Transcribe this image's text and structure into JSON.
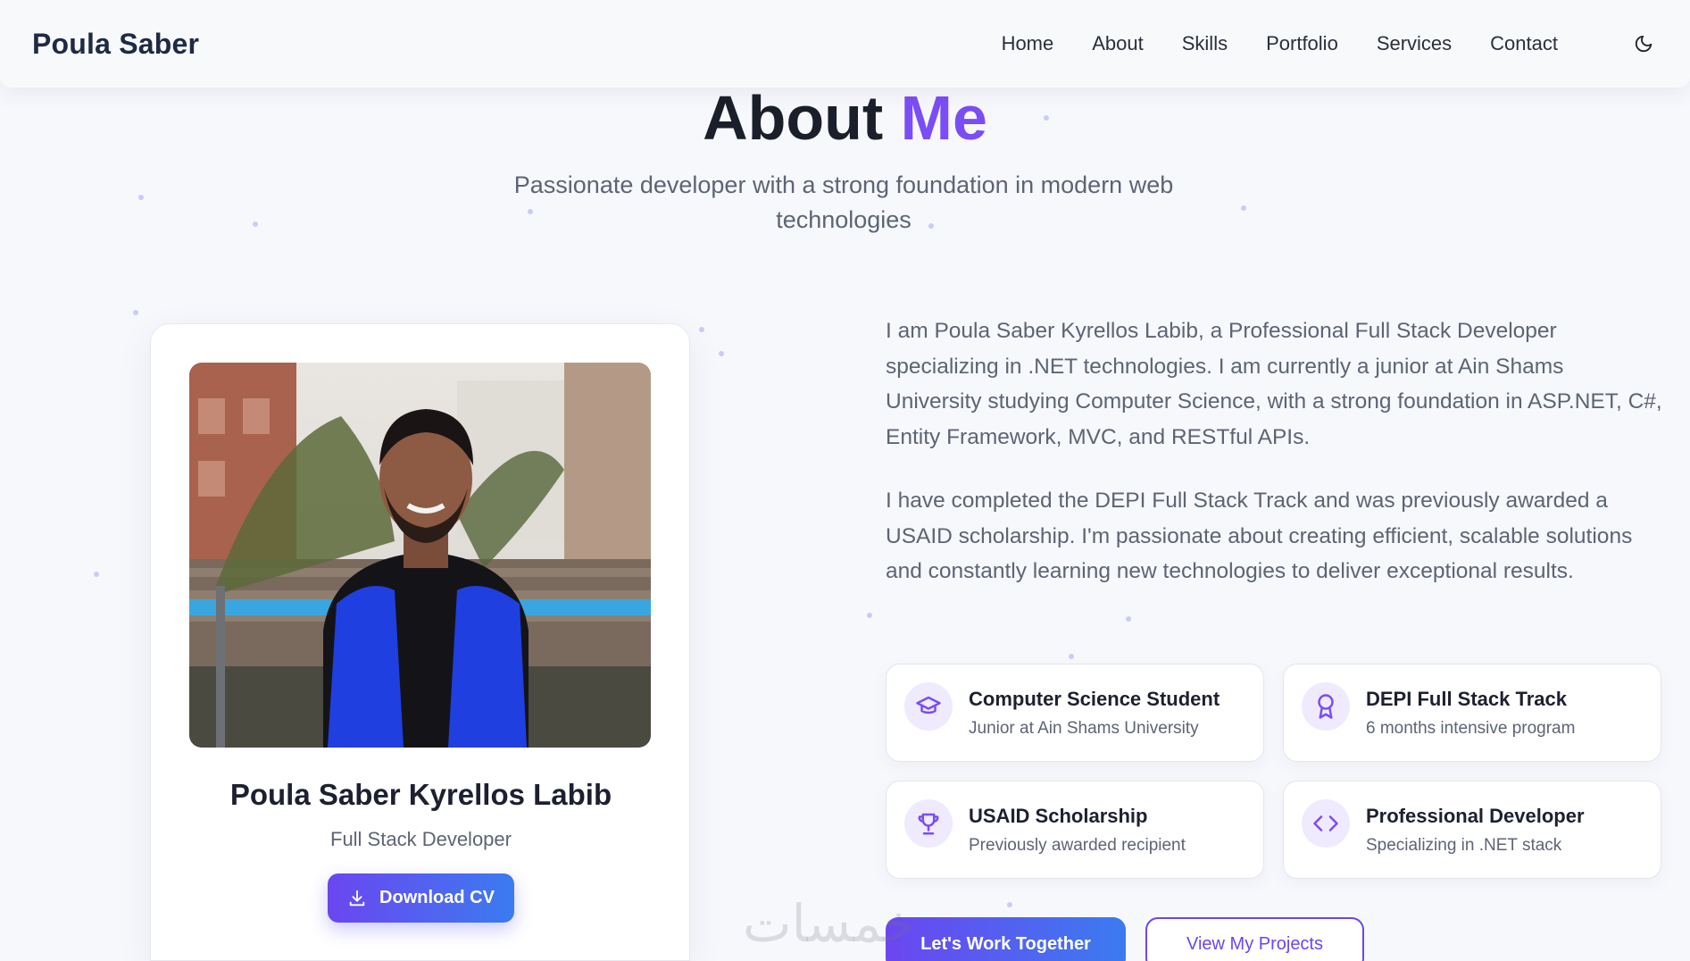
{
  "navbar": {
    "brand": "Poula Saber",
    "links": [
      "Home",
      "About",
      "Skills",
      "Portfolio",
      "Services",
      "Contact"
    ],
    "theme_icon": "moon-icon"
  },
  "header": {
    "title_main": "About",
    "title_accent": "Me",
    "subtitle": "Passionate developer with a strong foundation in modern web technologies"
  },
  "profile": {
    "name": "Poula Saber Kyrellos Labib",
    "role": "Full Stack Developer",
    "cv_button": "Download CV"
  },
  "bio": [
    "I am Poula Saber Kyrellos Labib, a Professional Full Stack Developer specializing in .NET technologies. I am currently a junior at Ain Shams University studying Computer Science, with a strong foundation in ASP.NET, C#, Entity Framework, MVC, and RESTful APIs.",
    "I have completed the DEPI Full Stack Track and was previously awarded a USAID scholarship. I'm passionate about creating efficient, scalable solutions and constantly learning new technologies to deliver exceptional results."
  ],
  "highlights": [
    {
      "icon": "graduation-cap-icon",
      "title": "Computer Science Student",
      "subtitle": "Junior at Ain Shams University"
    },
    {
      "icon": "award-icon",
      "title": "DEPI Full Stack Track",
      "subtitle": "6 months intensive program"
    },
    {
      "icon": "trophy-icon",
      "title": "USAID Scholarship",
      "subtitle": "Previously awarded recipient"
    },
    {
      "icon": "code-icon",
      "title": "Professional Developer",
      "subtitle": "Specializing in .NET stack"
    }
  ],
  "cta": {
    "primary": "Let's Work Together",
    "secondary": "View My Projects"
  },
  "watermark": "خمسات",
  "colors": {
    "accent": "#7b4df6",
    "gradient_start": "#6b46f0",
    "gradient_end": "#3b7bf0",
    "icon_bg": "#efeafd"
  }
}
